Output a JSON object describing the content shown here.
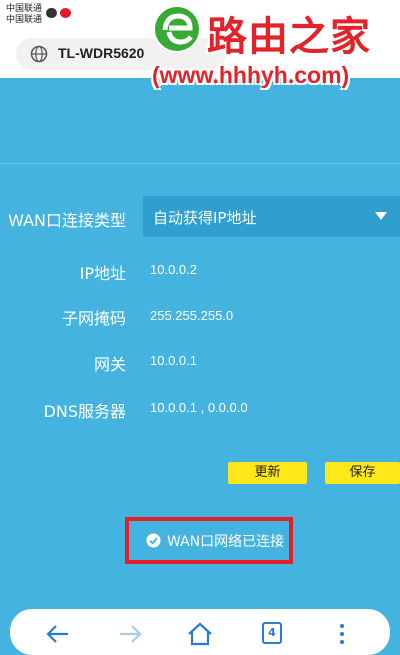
{
  "status_bar": {
    "carrier_1": "中国联通",
    "carrier_2": "中国联通"
  },
  "address_bar": {
    "url": "TL-WDR5620"
  },
  "watermark": {
    "brand": "路由之家",
    "url": "(www.hhhyh.com)"
  },
  "form": {
    "wan_type_label": "WAN口连接类型",
    "wan_type_value": "自动获得IP地址",
    "ip_label": "IP地址",
    "ip_value": "10.0.0.2",
    "mask_label": "子网掩码",
    "mask_value": "255.255.255.0",
    "gateway_label": "网关",
    "gateway_value": "10.0.0.1",
    "dns_label": "DNS服务器",
    "dns_value": "10.0.0.1 , 0.0.0.0"
  },
  "buttons": {
    "refresh": "更新",
    "save": "保存"
  },
  "status": {
    "message": "WAN口网络已连接"
  },
  "bottom_nav": {
    "tab_count": "4"
  },
  "colors": {
    "background": "#44b3e0",
    "select": "#2f9fd0",
    "button": "#ffe81a",
    "highlight": "#e32124",
    "nav_icon": "#2a7bd6"
  }
}
